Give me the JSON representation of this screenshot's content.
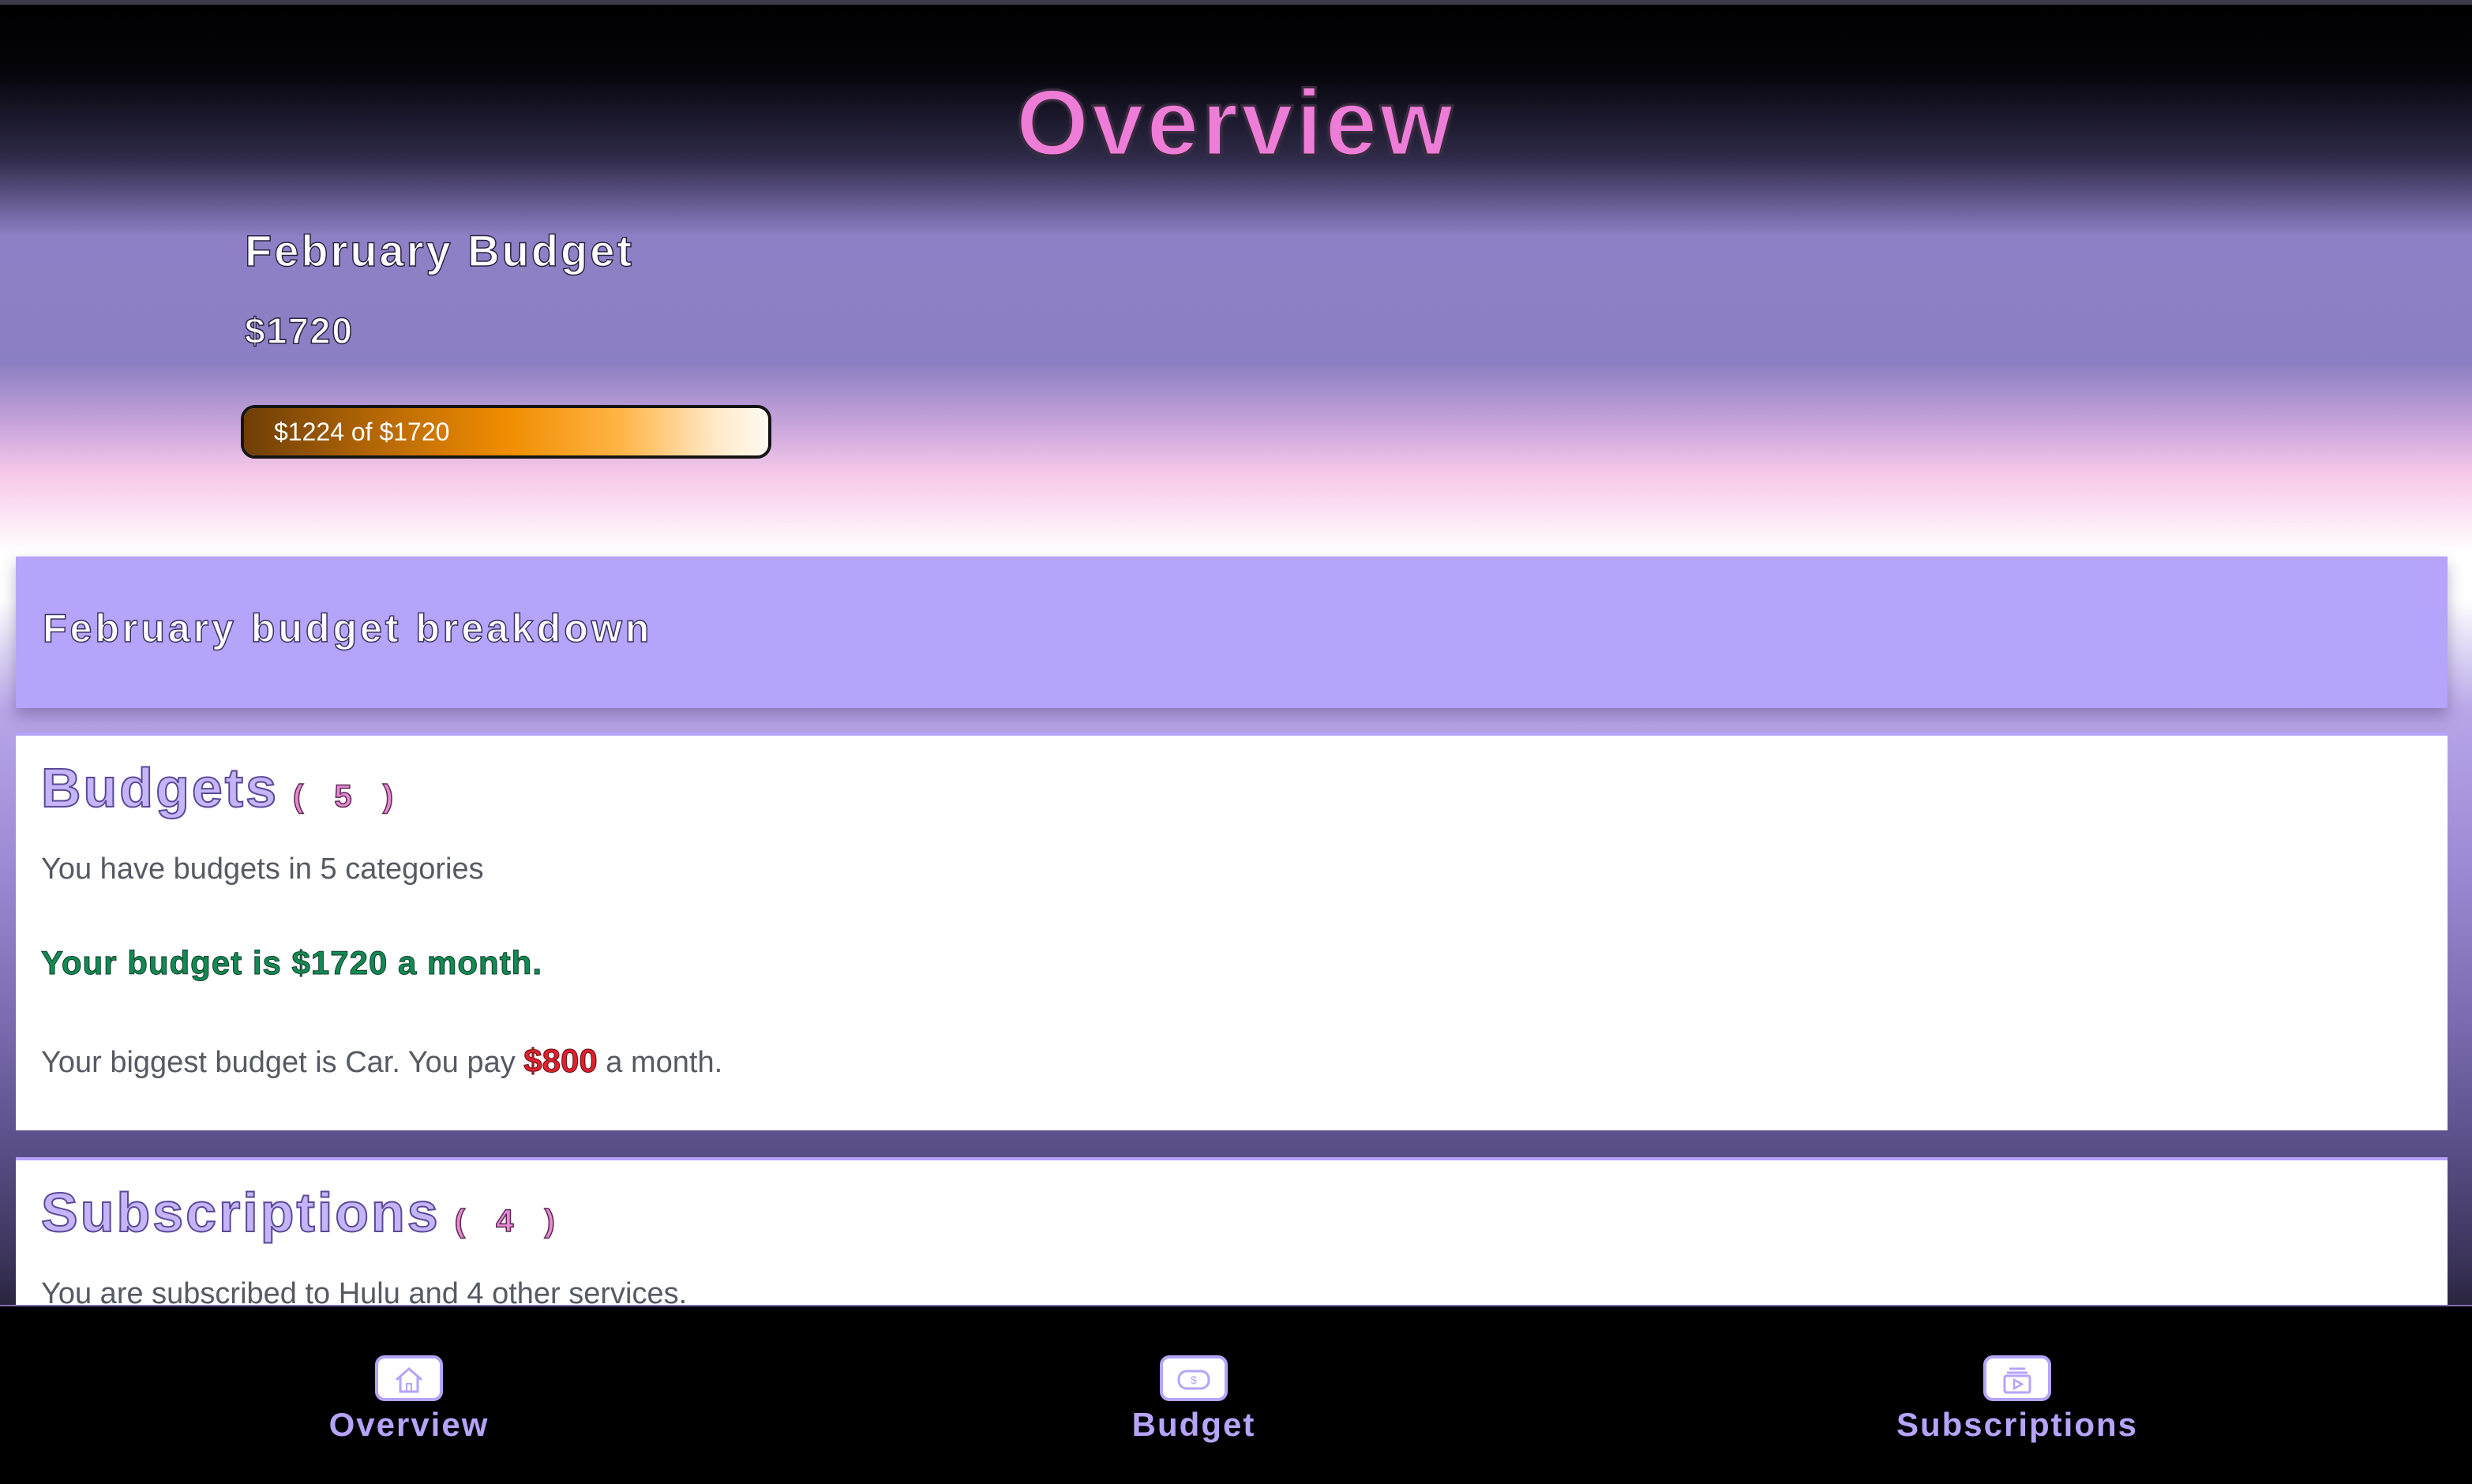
{
  "header": {
    "title": "Overview"
  },
  "monthly_budget": {
    "heading": "February Budget",
    "amount": "$1720",
    "progress_label": "$1224 of $1720",
    "spent": 1224,
    "total": 1720,
    "progress_fraction": 0.7116
  },
  "breakdown": {
    "title": "February budget breakdown"
  },
  "budgets_card": {
    "title": "Budgets",
    "count": "( 5 )",
    "summary": "You have budgets in 5 categories",
    "total_line": "Your budget is $1720 a month.",
    "biggest_prefix": "Your biggest budget is Car. You pay",
    "biggest_amount": "$800",
    "biggest_suffix": "a month."
  },
  "subscriptions_card": {
    "title": "Subscriptions",
    "count": "( 4 )",
    "summary": "You are subscribed to Hulu and 4 other services."
  },
  "bottom_nav": {
    "items": [
      {
        "label": "Overview",
        "icon": "home-icon"
      },
      {
        "label": "Budget",
        "icon": "money-icon"
      },
      {
        "label": "Subscriptions",
        "icon": "play-icon"
      }
    ]
  },
  "colors": {
    "accent": "#b6a3fa",
    "title_pink": "#ee7dd8",
    "total_green": "#138a54",
    "amount_red": "#e0202e",
    "progress_orange": "#f08c00"
  }
}
